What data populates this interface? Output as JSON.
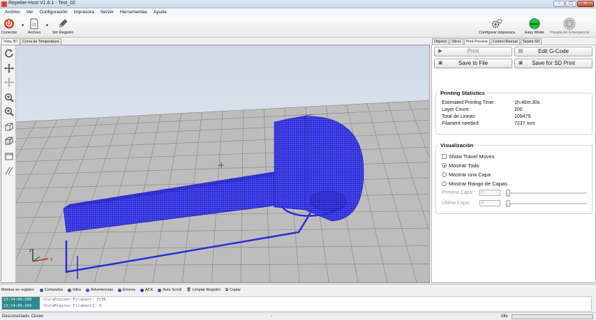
{
  "window": {
    "title": "Repetier-Host V1.6.1 - Test_02"
  },
  "menu": [
    "Archivo",
    "Ver",
    "Configuración",
    "Impresora",
    "Server",
    "Herramientas",
    "Ayuda"
  ],
  "toolbar": {
    "connect": "Conectar",
    "file": "Archivo",
    "log": "Ver Registro",
    "printer_config": "Configurar Impresora",
    "easy_mode": "Easy Mode",
    "easy_badge": "EASY",
    "emergency": "Parada de Emergencia"
  },
  "left_tabs": [
    "Vista 3D",
    "Curva de Temperatura"
  ],
  "right_tabs": [
    "Objetos",
    "Slicer",
    "Print Preview",
    "Control Manual",
    "Tarjeta SD"
  ],
  "preview": {
    "print": "Print",
    "edit_gcode": "Edit G-Code",
    "save_file": "Save to File",
    "save_sd": "Save for SD Print"
  },
  "stats": {
    "title": "Printing Statistics",
    "rows": [
      {
        "label": "Estimated Printing Time:",
        "value": "1h:40m:30s"
      },
      {
        "label": "Layer Count:",
        "value": "200"
      },
      {
        "label": "Total de Lineas:",
        "value": "109475"
      },
      {
        "label": "Filament needed:",
        "value": "7237 mm"
      }
    ]
  },
  "visual": {
    "title": "Visualización",
    "show_travel": "Show Travel Moves",
    "show_all": "Mostrar Todo",
    "show_one": "Mostrar una Capa",
    "show_range": "Mostrar Rango de Capas",
    "first_layer": "Primera Capa:",
    "last_layer": "Última Capa:",
    "first_val": "0",
    "last_val": "0"
  },
  "log": {
    "label": "Mostrar en registro:",
    "options": [
      "Comandos",
      "Infos",
      "Advertencias",
      "Errores",
      "ACK",
      "Auto Scroll"
    ],
    "clear": "Limpiar Registro",
    "copy": "Copiar",
    "lines": [
      {
        "time": "13:14:00.260",
        "msg": "<CuraEngine> Filament: 7236"
      },
      {
        "time": "13:14:00.260",
        "msg": "<CuraEngine> Filament2: 0"
      }
    ]
  },
  "status": {
    "connection": "Desconectado: Cloner",
    "middle": "-",
    "idle": "Idle"
  },
  "axes": {
    "x": "x",
    "z": "z"
  },
  "colors": {
    "model": "#2b2bd6",
    "floor": "#b9b9b9",
    "sky": "#dde5ee",
    "log_time_bg": "#2f8a8d"
  }
}
